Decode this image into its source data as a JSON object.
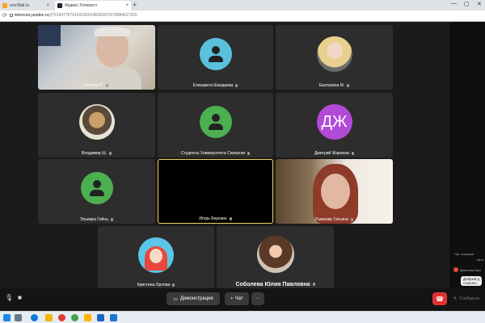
{
  "browser": {
    "tabs": [
      {
        "label": "нта Mail.ru",
        "active": false
      },
      {
        "label": "Яндекс.Телемост",
        "active": true
      }
    ],
    "new_tab_label": "+",
    "url_host": "telemost.yandex.ru",
    "url_path": "/j/75194776741020325348283470278084627926"
  },
  "participants": [
    {
      "name": "Виктор П.",
      "kind": "video"
    },
    {
      "name": "Елизавета Шандаева",
      "kind": "placeholder"
    },
    {
      "name": "Екатерина М.",
      "kind": "photo"
    },
    {
      "name": "Владимир Ш.",
      "kind": "photo"
    },
    {
      "name": "Студенты Университета Синергия",
      "kind": "placeholder"
    },
    {
      "name": "Дмитрий Жаринов",
      "kind": "initials",
      "initials": "ДЖ"
    },
    {
      "name": "Эльвира Гейнц",
      "kind": "placeholder"
    },
    {
      "name": "Игорь Березин",
      "kind": "video-off",
      "speaking": true
    },
    {
      "name": "Рыжкова Татьяна",
      "kind": "video"
    },
    {
      "name": "Кристина Орлова",
      "kind": "photo"
    },
    {
      "name": "Соболева Юлия Павловна",
      "kind": "photo"
    }
  ],
  "chat": {
    "history_note_1": "Чат сохранит",
    "history_note_2": "авто",
    "sender": "Кристина Орл",
    "message_1": "Добрый д",
    "message_2": "слышно"
  },
  "toolbar": {
    "demo_label": "Демонстрация",
    "chat_label": "Чат",
    "more_label": "···",
    "message_placeholder": "Сообщени"
  },
  "colors": {
    "speaking_border": "#f3d35e",
    "hangup": "#e03131",
    "avatar_blue": "#5bc0de",
    "avatar_green": "#4caf50",
    "avatar_purple": "#b24ad8"
  }
}
